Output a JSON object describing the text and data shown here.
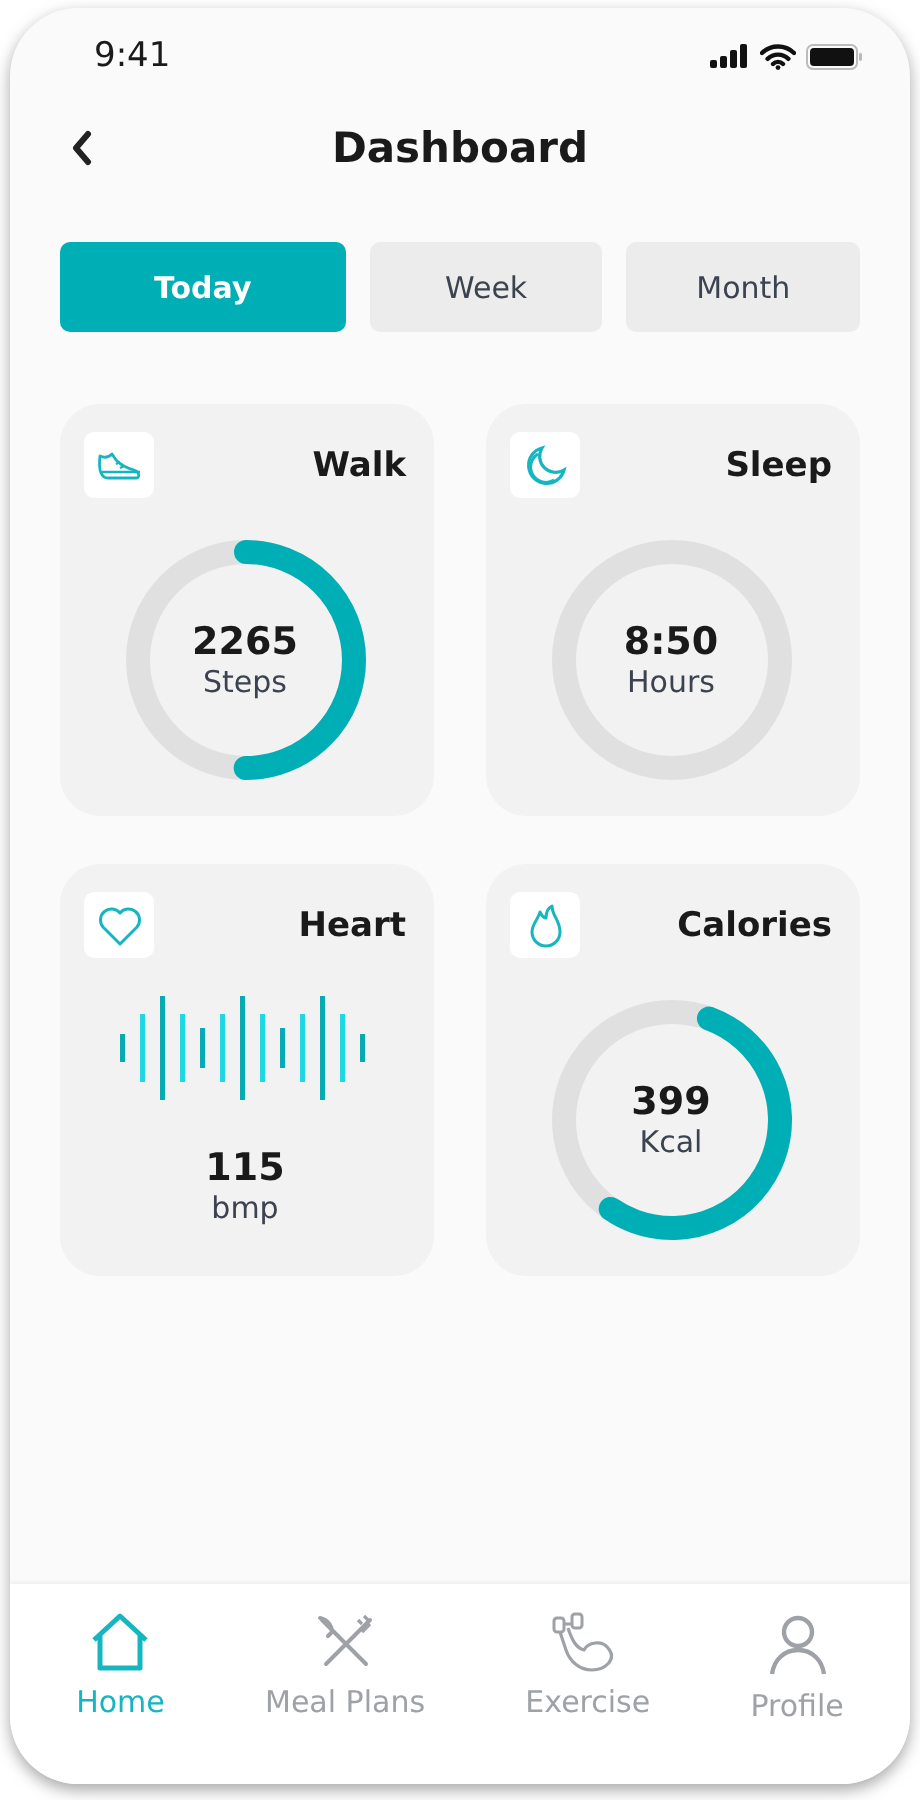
{
  "status_bar": {
    "time": "9:41"
  },
  "header": {
    "title": "Dashboard"
  },
  "tabs": [
    {
      "label": "Today",
      "selected": true
    },
    {
      "label": "Week",
      "selected": false
    },
    {
      "label": "Month",
      "selected": false
    }
  ],
  "cards": [
    {
      "title": "Walk",
      "kind": "ring",
      "value": "2265",
      "unit": "Steps"
    },
    {
      "title": "Sleep",
      "kind": "ring",
      "value": "8:50",
      "unit": "Hours"
    },
    {
      "title": "Heart",
      "kind": "wave",
      "value": "115",
      "unit": "bmp"
    },
    {
      "title": "Calories",
      "kind": "ring",
      "value": "399",
      "unit": "Kcal"
    }
  ],
  "nav": [
    {
      "label": "Home",
      "selected": true
    },
    {
      "label": "Meal Plans",
      "selected": false
    },
    {
      "label": "Exercise",
      "selected": false
    },
    {
      "label": "Profile",
      "selected": false
    }
  ]
}
